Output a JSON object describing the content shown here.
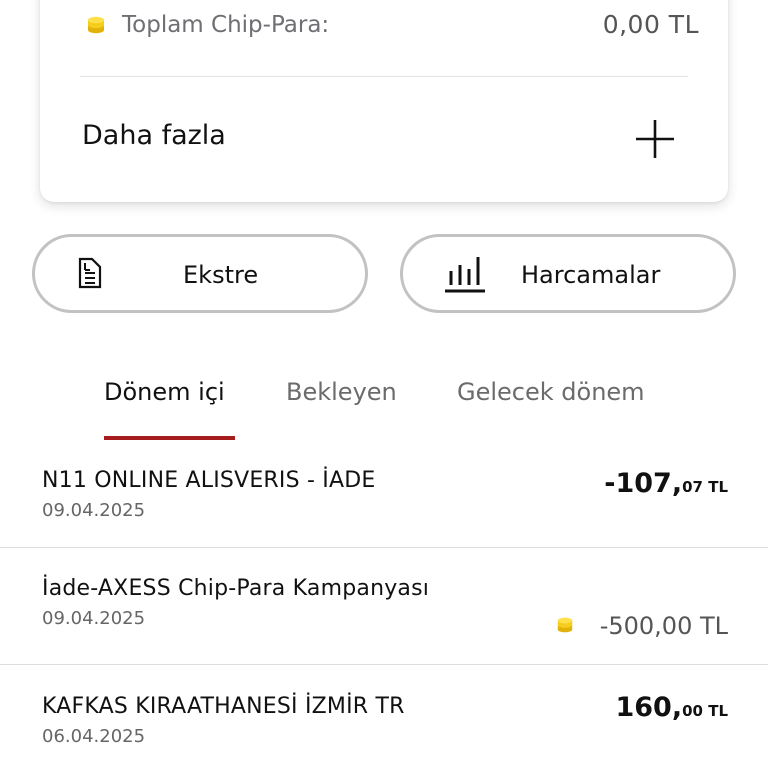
{
  "summary": {
    "chip_label": "Toplam Chip-Para:",
    "chip_value": "0,00 TL",
    "more_label": "Daha fazla"
  },
  "actions": {
    "statement_label": "Ekstre",
    "spending_label": "Harcamalar"
  },
  "tabs": [
    {
      "label": "Dönem içi",
      "active": true
    },
    {
      "label": "Bekleyen",
      "active": false
    },
    {
      "label": "Gelecek dönem",
      "active": false
    }
  ],
  "transactions": [
    {
      "name": "N11 ONLINE ALISVERIS - İADE",
      "date": "09.04.2025",
      "amount_main": "-107,",
      "amount_dec": "07 TL"
    },
    {
      "name": "İade-AXESS Chip-Para Kampanyası",
      "date": "09.04.2025",
      "chip_amount": "-500,00 TL"
    },
    {
      "name": "KAFKAS KIRAATHANESİ İZMİR TR",
      "date": "06.04.2025",
      "amount_main": "160,",
      "amount_dec": "00 TL"
    }
  ],
  "icons": {
    "coin": "coin-icon",
    "plus": "plus-icon",
    "statement": "statement-icon",
    "chart": "bar-chart-icon"
  },
  "colors": {
    "accent": "#a61c1c",
    "coin": "#f2c511"
  }
}
